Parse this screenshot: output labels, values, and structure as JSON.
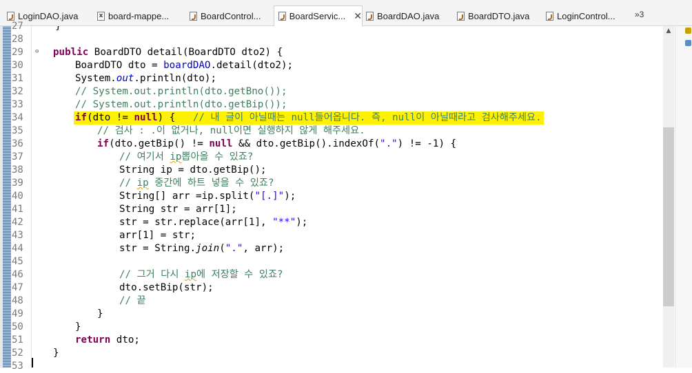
{
  "tabs": [
    {
      "label": "LoginDAO.java",
      "icon": "java-file-icon",
      "active": false
    },
    {
      "label": "board-mappe...",
      "icon": "xml-file-icon",
      "active": false
    },
    {
      "label": "BoardControl...",
      "icon": "java-file-icon",
      "active": false
    },
    {
      "label": "BoardServic...",
      "icon": "java-file-icon",
      "active": true
    },
    {
      "label": "BoardDAO.java",
      "icon": "java-file-icon",
      "active": false
    },
    {
      "label": "BoardDTO.java",
      "icon": "java-file-icon",
      "active": false
    },
    {
      "label": "LoginControl...",
      "icon": "java-file-icon",
      "active": false
    }
  ],
  "overflow_label": "»3",
  "line_numbers": [
    "27",
    "28",
    "29",
    "30",
    "31",
    "32",
    "33",
    "34",
    "35",
    "36",
    "37",
    "38",
    "39",
    "40",
    "41",
    "42",
    "43",
    "44",
    "45",
    "46",
    "47",
    "48",
    "49",
    "50",
    "51",
    "52",
    "53"
  ],
  "code": {
    "l27": "    }",
    "l29_kw": "public",
    "l29_rest": " BoardDTO detail(BoardDTO dto2) {",
    "l30_a": "BoardDTO dto = ",
    "l30_field": "boardDAO",
    "l30_b": ".detail(dto2);",
    "l31_a": "System.",
    "l31_field": "out",
    "l31_b": ".println(dto);",
    "l32": "// System.out.println(dto.getBno());",
    "l33": "// System.out.println(dto.getBip());",
    "l34_kw": "if",
    "l34_a": "(dto != ",
    "l34_null": "null",
    "l34_b": ") {   ",
    "l34_cm": "// 내 글이 아닐때는 null들어옵니다. 즉, null이 아닐때라고 검사해주세요.",
    "l35": "// 검사 : .이 없거나, null이면 실행하지 않게 해주세요.",
    "l36_kw": "if",
    "l36_a": "(dto.getBip() != ",
    "l36_null": "null",
    "l36_b": " && dto.getBip().indexOf(",
    "l36_str": "\".\"",
    "l36_c": ") != -1) {",
    "l37_pre": "// 여기서 ",
    "l37_sq": "ip",
    "l37_post": "뽑아올 수 있죠?",
    "l38": "String ip = dto.getBip();",
    "l39_pre": "// ",
    "l39_sq": "ip",
    "l39_post": " 중간에 하트 넣을 수 있죠?",
    "l40_a": "String[] arr =ip.split(",
    "l40_str": "\"[.]\"",
    "l40_b": ");",
    "l41": "String str = arr[1];",
    "l42_a": "str = str.replace(arr[1], ",
    "l42_str": "\"**\"",
    "l42_b": ");",
    "l43": "arr[1] = str;",
    "l44_a": "str = String.",
    "l44_it": "join",
    "l44_b": "(",
    "l44_str": "\".\"",
    "l44_c": ", arr);",
    "l46_pre": "// 그거 다시 ",
    "l46_sq": "ip",
    "l46_post": "에 저장할 수 있죠?",
    "l47": "dto.setBip(str);",
    "l48": "// 끝",
    "l49": "}",
    "l50": "}",
    "l51_kw": "return",
    "l51_rest": " dto;",
    "l52": "}"
  },
  "colors": {
    "keyword": "#7f0055",
    "comment": "#3f7f5f",
    "string": "#2a00ff",
    "field": "#0000c0",
    "highlight": "#fff200"
  }
}
